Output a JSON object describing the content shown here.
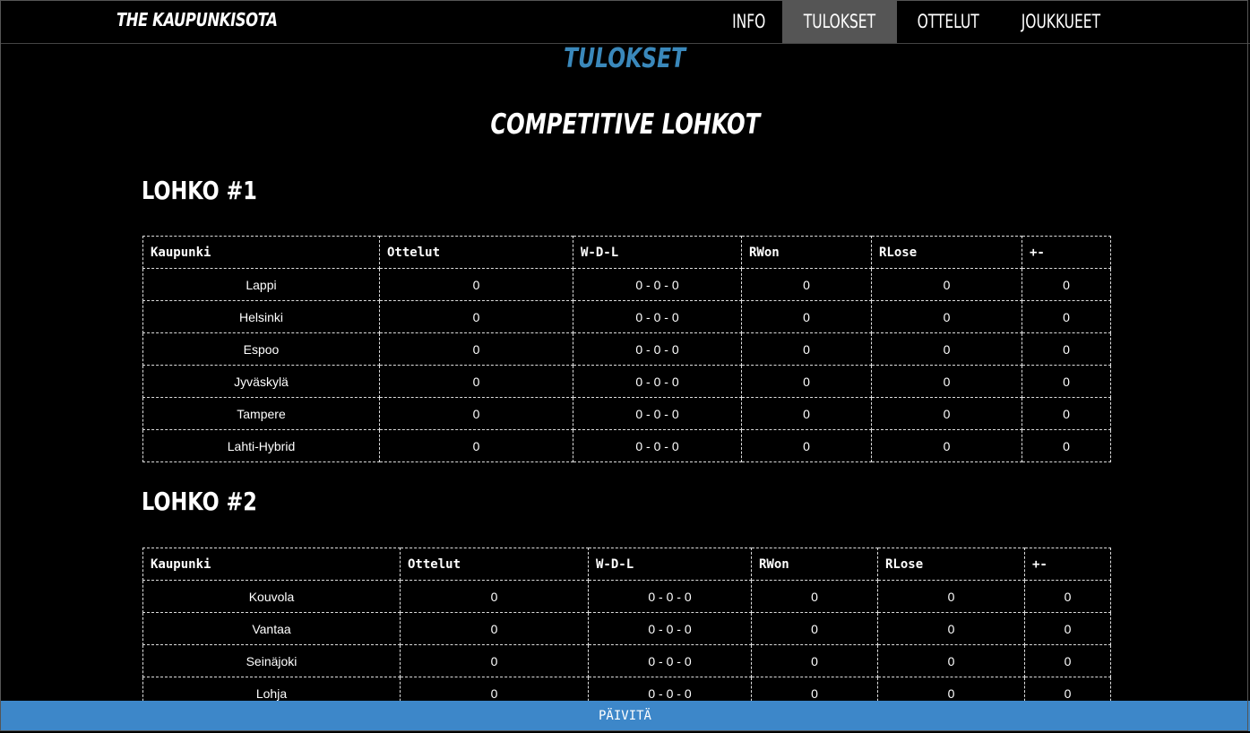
{
  "header": {
    "brand": "THE KAUPUNKISOTA",
    "nav": [
      {
        "label": "INFO",
        "active": false
      },
      {
        "label": "TULOKSET",
        "active": true
      },
      {
        "label": "OTTELUT",
        "active": false
      },
      {
        "label": "JOUKKUEET",
        "active": false
      }
    ]
  },
  "main": {
    "page_title": "TULOKSET",
    "section_title": "COMPETITIVE LOHKOT",
    "columns": [
      "Kaupunki",
      "Ottelut",
      "W-D-L",
      "RWon",
      "RLose",
      "+-"
    ],
    "groups": [
      {
        "title": "LOHKO #1",
        "rows": [
          [
            "Lappi",
            "0",
            "0 - 0 - 0",
            "0",
            "0",
            "0"
          ],
          [
            "Helsinki",
            "0",
            "0 - 0 - 0",
            "0",
            "0",
            "0"
          ],
          [
            "Espoo",
            "0",
            "0 - 0 - 0",
            "0",
            "0",
            "0"
          ],
          [
            "Jyväskylä",
            "0",
            "0 - 0 - 0",
            "0",
            "0",
            "0"
          ],
          [
            "Tampere",
            "0",
            "0 - 0 - 0",
            "0",
            "0",
            "0"
          ],
          [
            "Lahti-Hybrid",
            "0",
            "0 - 0 - 0",
            "0",
            "0",
            "0"
          ]
        ]
      },
      {
        "title": "LOHKO #2",
        "rows": [
          [
            "Kouvola",
            "0",
            "0 - 0 - 0",
            "0",
            "0",
            "0"
          ],
          [
            "Vantaa",
            "0",
            "0 - 0 - 0",
            "0",
            "0",
            "0"
          ],
          [
            "Seinäjoki",
            "0",
            "0 - 0 - 0",
            "0",
            "0",
            "0"
          ],
          [
            "Lohja",
            "0",
            "0 - 0 - 0",
            "0",
            "0",
            "0"
          ]
        ]
      }
    ]
  },
  "footer": {
    "refresh_label": "PÄIVITÄ",
    "accent_color": "#3d87c9"
  }
}
